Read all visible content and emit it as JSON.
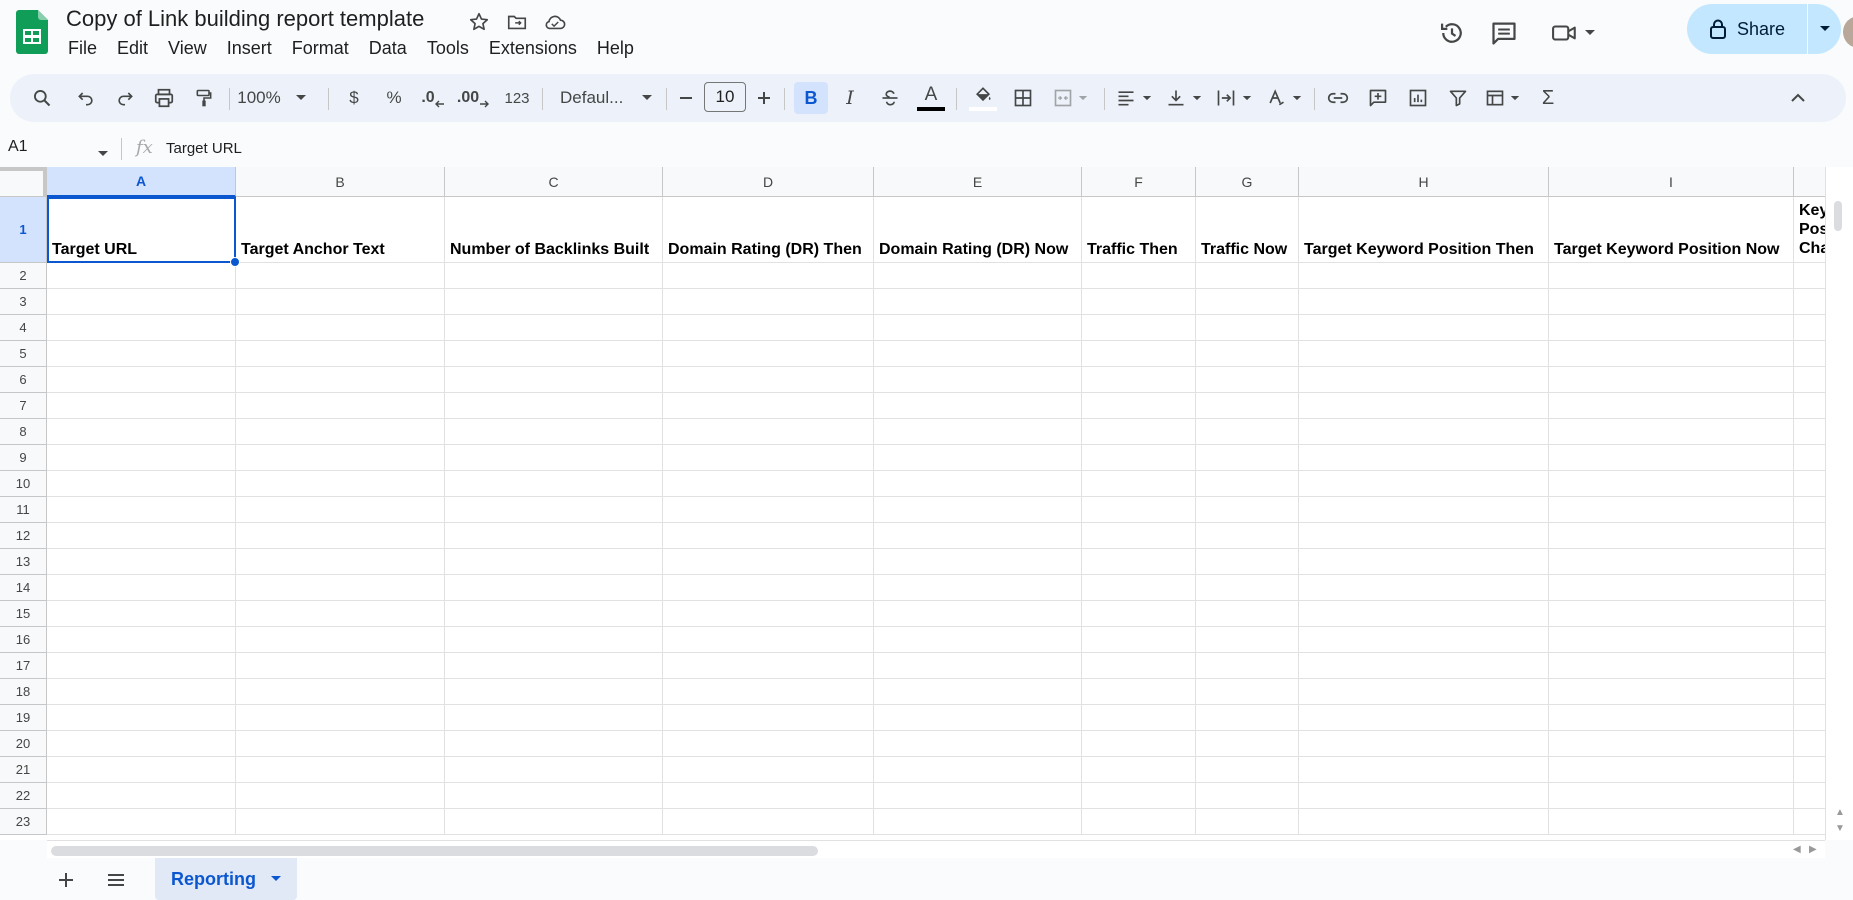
{
  "app": {
    "doc_title": "Copy of Link building report template",
    "menu": [
      "File",
      "Edit",
      "View",
      "Insert",
      "Format",
      "Data",
      "Tools",
      "Extensions",
      "Help"
    ],
    "share_label": "Share",
    "accent_color": "#0b57d0",
    "logo_color": "#0f9d58"
  },
  "toolbar": {
    "zoom": "100%",
    "currency": "$",
    "percent": "%",
    "decrease_decimal": ".0",
    "increase_decimal": ".00",
    "number_format": "123",
    "font": "Defaul...",
    "font_size": "10",
    "bold_label": "B",
    "italic_label": "I",
    "text_color_label": "A",
    "sum_label": "Σ"
  },
  "formula_bar": {
    "cell_ref": "A1",
    "fx_label": "fx",
    "content": "Target URL"
  },
  "sheet": {
    "columns": [
      "A",
      "B",
      "C",
      "D",
      "E",
      "F",
      "G",
      "H",
      "I",
      ""
    ],
    "header_row": [
      "Target URL",
      "Target Anchor Text",
      "Number of Backlinks Built",
      "Domain Rating (DR) Then",
      "Domain Rating (DR) Now",
      "Traffic Then",
      "Traffic Now",
      "Target Keyword Position Then",
      "Target Keyword Position Now",
      "Keyword Position Change"
    ],
    "rows": [
      "1",
      "2",
      "3",
      "4",
      "5",
      "6",
      "7",
      "8",
      "9",
      "10",
      "11",
      "12",
      "13",
      "14",
      "15",
      "16",
      "17",
      "18",
      "19",
      "20",
      "21",
      "22",
      "23"
    ],
    "selected_cell": "A1"
  },
  "tabs": {
    "active_sheet": "Reporting"
  }
}
